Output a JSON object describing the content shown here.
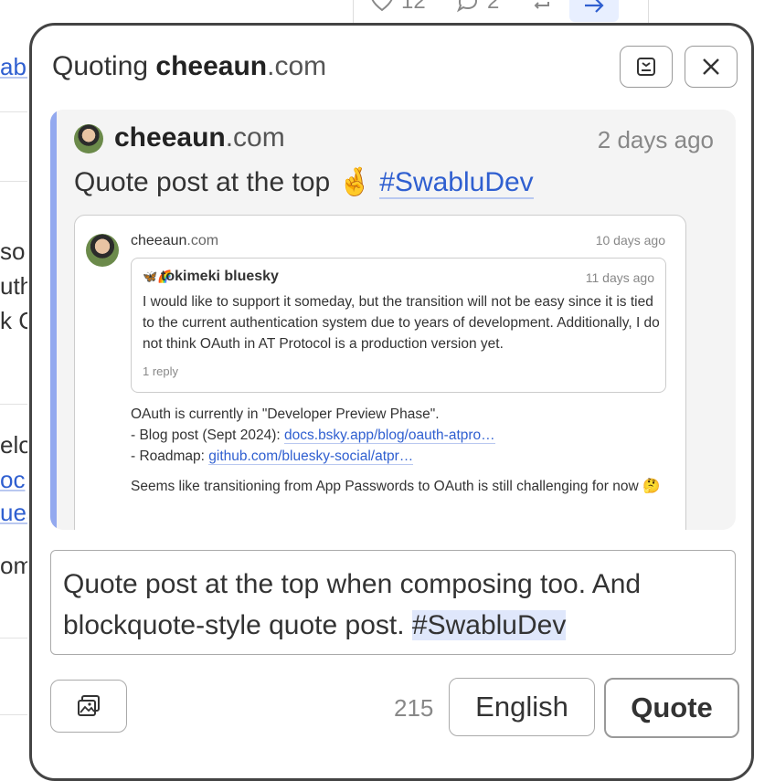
{
  "background": {
    "fragments": [
      "abl",
      "so",
      "uth",
      "k C",
      "elo",
      "oc",
      "ues",
      "om"
    ],
    "stats": {
      "likes": "12",
      "replies": "2"
    }
  },
  "modal": {
    "title_prefix": "Quoting ",
    "title_handle_main": "cheeaun",
    "title_handle_domain": ".com",
    "icons": {
      "minimize": "minimize-icon",
      "close": "close-icon"
    }
  },
  "quoted_post": {
    "handle_main": "cheeaun",
    "handle_domain": ".com",
    "time": "2 days ago",
    "text": "Quote post at the top",
    "emoji": "🤞",
    "hashtag": "#SwabluDev",
    "embedded": {
      "handle_main": "cheeaun",
      "handle_domain": ".com",
      "time": "10 days ago",
      "inner": {
        "icon": "🦋🌈",
        "handle": "tokimeki bluesky",
        "time": "11 days ago",
        "text": "I would like to support it someday, but the transition will not be easy since it is tied to the current authentication system due to years of development. Additionally, I do not think OAuth in AT Protocol is a production version yet.",
        "replies": "1 reply"
      },
      "body_line1": "OAuth is currently in \"Developer Preview Phase\".",
      "body_line2_prefix": "- Blog post (Sept 2024): ",
      "body_line2_link": "docs.bsky.app/blog/oauth-atpro…",
      "body_line3_prefix": "- Roadmap: ",
      "body_line3_link": "github.com/bluesky-social/atpr…",
      "body_para2": "Seems like transitioning from App Passwords to OAuth is still challenging for now 🤔"
    }
  },
  "compose": {
    "text": "Quote post at the top when composing too. And blockquote-style quote post. ",
    "hashtag": "#SwabluDev"
  },
  "footer": {
    "char_count": "215",
    "language": "English",
    "submit": "Quote",
    "image_icon": "image-icon"
  },
  "colors": {
    "accent": "#2f5fd0",
    "quote_bar": "#93a9ef",
    "highlight": "#dfe7fb"
  }
}
